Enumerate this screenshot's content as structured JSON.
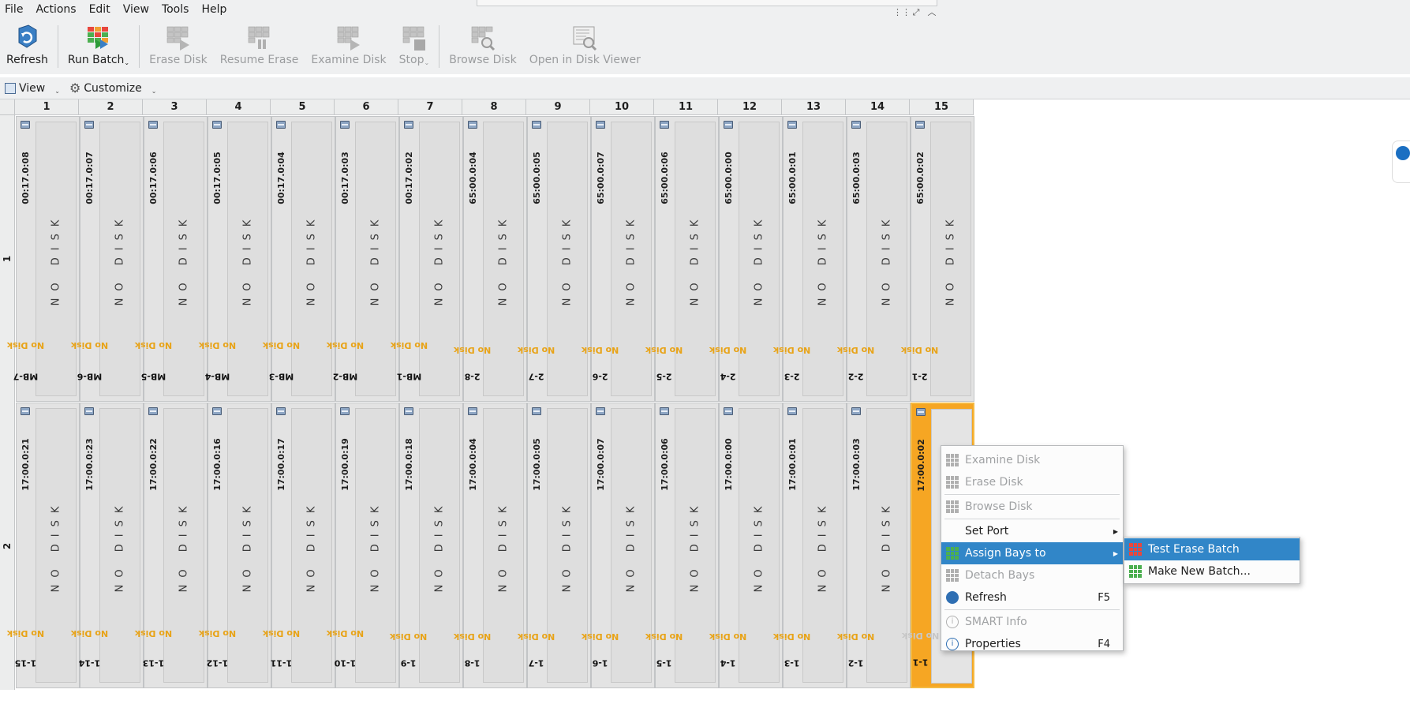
{
  "menu": [
    "File",
    "Actions",
    "Edit",
    "View",
    "Tools",
    "Help"
  ],
  "toolbar": {
    "refresh": "Refresh",
    "run_batch": "Run Batch",
    "erase_disk": "Erase Disk",
    "resume_erase": "Resume Erase",
    "examine_disk": "Examine Disk",
    "stop": "Stop",
    "browse_disk": "Browse Disk",
    "open_disk_viewer": "Open in Disk Viewer"
  },
  "subtoolbar": {
    "view": "View",
    "customize": "Customize"
  },
  "columns": [
    "1",
    "2",
    "3",
    "4",
    "5",
    "6",
    "7",
    "8",
    "9",
    "10",
    "11",
    "12",
    "13",
    "14",
    "15"
  ],
  "rows": [
    "1",
    "2"
  ],
  "no_disk_text": "NO DISK",
  "row1": [
    {
      "port": "00:17.0:08",
      "name": "MB-7",
      "status": "No Disk"
    },
    {
      "port": "00:17.0:07",
      "name": "MB-6",
      "status": "No Disk"
    },
    {
      "port": "00:17.0:06",
      "name": "MB-5",
      "status": "No Disk"
    },
    {
      "port": "00:17.0:05",
      "name": "MB-4",
      "status": "No Disk"
    },
    {
      "port": "00:17.0:04",
      "name": "MB-3",
      "status": "No Disk"
    },
    {
      "port": "00:17.0:03",
      "name": "MB-2",
      "status": "No Disk"
    },
    {
      "port": "00:17.0:02",
      "name": "MB-1",
      "status": "No Disk"
    },
    {
      "port": "65:00.0:04",
      "name": "2-8",
      "status": "No Disk"
    },
    {
      "port": "65:00.0:05",
      "name": "2-7",
      "status": "No Disk"
    },
    {
      "port": "65:00.0:07",
      "name": "2-6",
      "status": "No Disk"
    },
    {
      "port": "65:00.0:06",
      "name": "2-5",
      "status": "No Disk"
    },
    {
      "port": "65:00.0:00",
      "name": "2-4",
      "status": "No Disk"
    },
    {
      "port": "65:00.0:01",
      "name": "2-3",
      "status": "No Disk"
    },
    {
      "port": "65:00.0:03",
      "name": "2-2",
      "status": "No Disk"
    },
    {
      "port": "65:00.0:02",
      "name": "2-1",
      "status": "No Disk"
    }
  ],
  "row2": [
    {
      "port": "17:00.0:21",
      "name": "1-15",
      "status": "No Disk"
    },
    {
      "port": "17:00.0:23",
      "name": "1-14",
      "status": "No Disk"
    },
    {
      "port": "17:00.0:22",
      "name": "1-13",
      "status": "No Disk"
    },
    {
      "port": "17:00.0:16",
      "name": "1-12",
      "status": "No Disk"
    },
    {
      "port": "17:00.0:17",
      "name": "1-11",
      "status": "No Disk"
    },
    {
      "port": "17:00.0:19",
      "name": "1-10",
      "status": "No Disk"
    },
    {
      "port": "17:00.0:18",
      "name": "1-9",
      "status": "No Disk"
    },
    {
      "port": "17:00.0:04",
      "name": "1-8",
      "status": "No Disk"
    },
    {
      "port": "17:00.0:05",
      "name": "1-7",
      "status": "No Disk"
    },
    {
      "port": "17:00.0:07",
      "name": "1-6",
      "status": "No Disk"
    },
    {
      "port": "17:00.0:06",
      "name": "1-5",
      "status": "No Disk"
    },
    {
      "port": "17:00.0:00",
      "name": "1-4",
      "status": "No Disk"
    },
    {
      "port": "17:00.0:01",
      "name": "1-3",
      "status": "No Disk"
    },
    {
      "port": "17:00.0:03",
      "name": "1-2",
      "status": "No Disk"
    },
    {
      "port": "17:00.0:02",
      "name": "1-1",
      "status": "No Disk"
    }
  ],
  "selected_bay": "1-1",
  "context_menu": {
    "examine_disk": "Examine Disk",
    "erase_disk": "Erase Disk",
    "browse_disk": "Browse Disk",
    "set_port": "Set Port",
    "assign_bays": "Assign Bays to",
    "detach_bays": "Detach Bays",
    "refresh": "Refresh",
    "refresh_shortcut": "F5",
    "smart_info": "SMART Info",
    "properties": "Properties",
    "properties_shortcut": "F4"
  },
  "submenu": {
    "test_erase_batch": "Test Erase Batch",
    "make_new_batch": "Make New Batch..."
  },
  "colors": {
    "selected_bay": "#f6a623",
    "status_no_disk": "#e8a317",
    "menu_highlight": "#3186c8"
  }
}
